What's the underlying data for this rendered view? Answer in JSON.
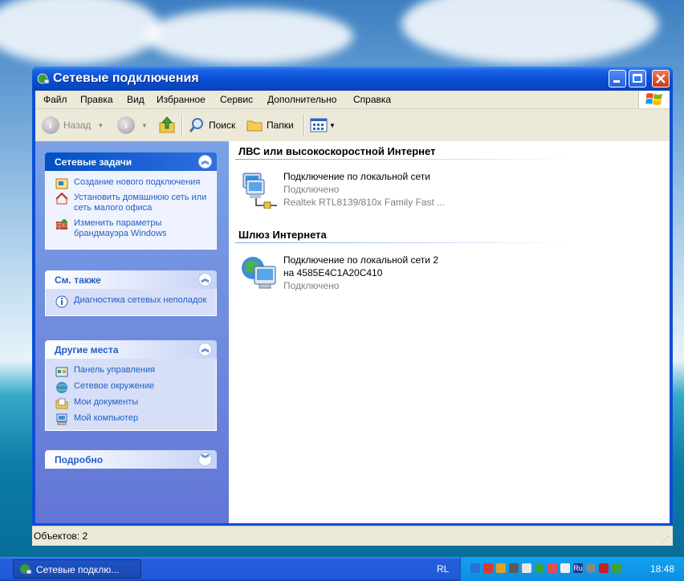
{
  "window": {
    "title": "Сетевые подключения",
    "menu": [
      "Файл",
      "Правка",
      "Вид",
      "Избранное",
      "Сервис",
      "Дополнительно",
      "Справка"
    ],
    "toolbar": {
      "back": "Назад",
      "search": "Поиск",
      "folders": "Папки"
    }
  },
  "left_pane": {
    "network_tasks": {
      "title": "Сетевые задачи",
      "links": [
        "Создание нового подключения",
        "Установить домашнюю сеть или сеть малого офиса",
        "Изменить параметры брандмауэра Windows"
      ]
    },
    "see_also": {
      "title": "См. также",
      "links": [
        "Диагностика сетевых неполадок"
      ]
    },
    "other_places": {
      "title": "Другие места",
      "links": [
        "Панель управления",
        "Сетевое окружение",
        "Мои документы",
        "Мой компьютер"
      ]
    },
    "details": {
      "title": "Подробно"
    }
  },
  "right_pane": {
    "group1": {
      "title": "ЛВС или высокоскоростной Интернет",
      "item": {
        "name": "Подключение по локальной сети",
        "status": "Подключено",
        "device": "Realtek RTL8139/810x Family Fast ..."
      }
    },
    "group2": {
      "title": "Шлюз Интернета",
      "item": {
        "name": "Подключение по локальной сети 2",
        "name2": "на 4585E4C1A20C410",
        "status": "Подключено"
      }
    }
  },
  "statusbar": {
    "text": "Объектов: 2"
  },
  "taskbar": {
    "task": "Сетевые подклю...",
    "lang": "RL",
    "clock": "18:48"
  }
}
